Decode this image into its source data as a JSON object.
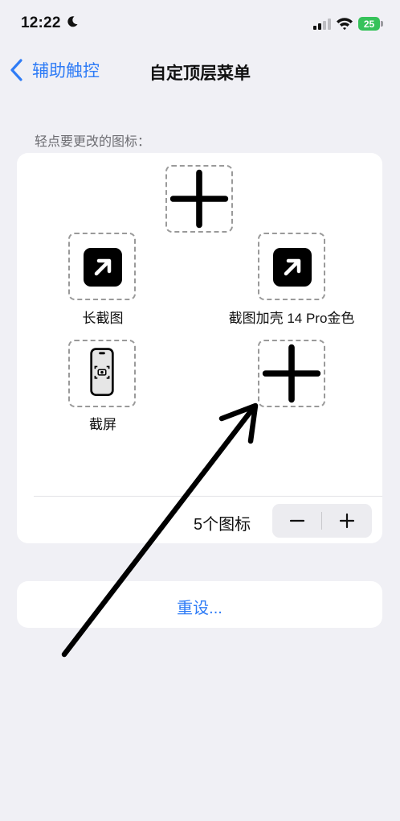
{
  "status_bar": {
    "time": "12:22",
    "battery": "25"
  },
  "nav": {
    "back_label": "辅助触控",
    "title": "自定顶层菜单"
  },
  "section_label": "轻点要更改的图标：",
  "slots": {
    "long_screenshot_label": "长截图",
    "screenshot_case_label": "截图加壳 14 Pro金色",
    "screenshot_label": "截屏"
  },
  "icon_count": {
    "label": "5个图标"
  },
  "reset": {
    "label": "重设..."
  },
  "colors": {
    "accent": "#2f7cf6",
    "background": "#f0f0f5",
    "battery": "#36c25a"
  }
}
